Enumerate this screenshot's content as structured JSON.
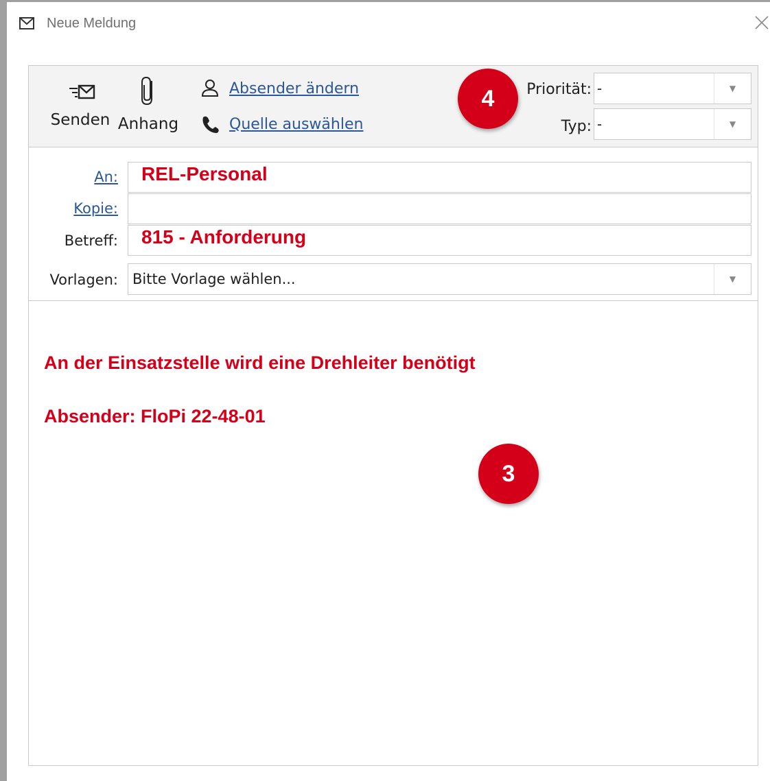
{
  "window": {
    "title": "Neue Meldung",
    "title_icon": "envelope-icon",
    "close_icon": "close-icon"
  },
  "ribbon": {
    "send_label": "Senden",
    "attach_label": "Anhang",
    "change_sender_label": "Absender ändern",
    "select_source_label": "Quelle auswählen",
    "priority_label": "Priorität:",
    "priority_value": "-",
    "type_label": "Typ:",
    "type_value": "-"
  },
  "fields": {
    "to_label": "An:",
    "to_value": "REL-Personal",
    "cc_label": "Kopie:",
    "cc_value": "",
    "subject_label": "Betreff:",
    "subject_value": "815 - Anforderung",
    "templates_label": "Vorlagen:",
    "templates_value": "Bitte Vorlage wählen..."
  },
  "body": {
    "line1": "An der Einsatzstelle wird eine Drehleiter benötigt",
    "line2": "Absender: FloPi 22-48-01"
  },
  "badges": {
    "badge_4": "4",
    "badge_3": "3"
  },
  "colors": {
    "highlight_red": "#d4001a",
    "link_blue": "#2b579a",
    "ribbon_bg": "#f3f3f3"
  }
}
